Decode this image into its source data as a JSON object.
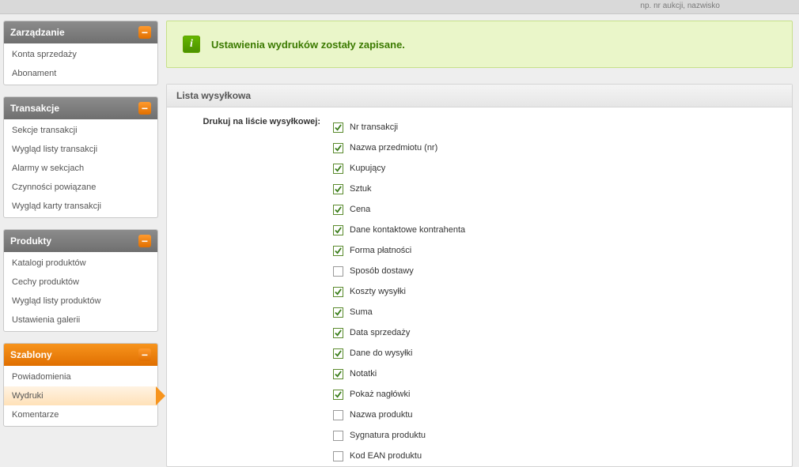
{
  "top_hint": "np. nr aukcji, nazwisko",
  "sidebar": {
    "groups": [
      {
        "title": "Zarządzanie",
        "style": "gray",
        "items": [
          {
            "label": "Konta sprzedaży",
            "active": false
          },
          {
            "label": "Abonament",
            "active": false
          }
        ]
      },
      {
        "title": "Transakcje",
        "style": "gray",
        "items": [
          {
            "label": "Sekcje transakcji",
            "active": false
          },
          {
            "label": "Wygląd listy transakcji",
            "active": false
          },
          {
            "label": "Alarmy w sekcjach",
            "active": false
          },
          {
            "label": "Czynności powiązane",
            "active": false
          },
          {
            "label": "Wygląd karty transakcji",
            "active": false
          }
        ]
      },
      {
        "title": "Produkty",
        "style": "gray",
        "items": [
          {
            "label": "Katalogi produktów",
            "active": false
          },
          {
            "label": "Cechy produktów",
            "active": false
          },
          {
            "label": "Wygląd listy produktów",
            "active": false
          },
          {
            "label": "Ustawienia galerii",
            "active": false
          }
        ]
      },
      {
        "title": "Szablony",
        "style": "orange",
        "items": [
          {
            "label": "Powiadomienia",
            "active": false
          },
          {
            "label": "Wydruki",
            "active": true
          },
          {
            "label": "Komentarze",
            "active": false
          }
        ]
      }
    ]
  },
  "notice": {
    "text": "Ustawienia wydruków zostały zapisane."
  },
  "panel": {
    "title": "Lista wysyłkowa",
    "form_label": "Drukuj na liście wysyłkowej:",
    "options": [
      {
        "label": "Nr transakcji",
        "checked": true
      },
      {
        "label": "Nazwa przedmiotu (nr)",
        "checked": true
      },
      {
        "label": "Kupujący",
        "checked": true
      },
      {
        "label": "Sztuk",
        "checked": true
      },
      {
        "label": "Cena",
        "checked": true
      },
      {
        "label": "Dane kontaktowe kontrahenta",
        "checked": true
      },
      {
        "label": "Forma płatności",
        "checked": true
      },
      {
        "label": "Sposób dostawy",
        "checked": false
      },
      {
        "label": "Koszty wysyłki",
        "checked": true
      },
      {
        "label": "Suma",
        "checked": true
      },
      {
        "label": "Data sprzedaży",
        "checked": true
      },
      {
        "label": "Dane do wysyłki",
        "checked": true
      },
      {
        "label": "Notatki",
        "checked": true
      },
      {
        "label": "Pokaż nagłówki",
        "checked": true
      },
      {
        "label": "Nazwa produktu",
        "checked": false
      },
      {
        "label": "Sygnatura produktu",
        "checked": false
      },
      {
        "label": "Kod EAN produktu",
        "checked": false
      }
    ]
  }
}
